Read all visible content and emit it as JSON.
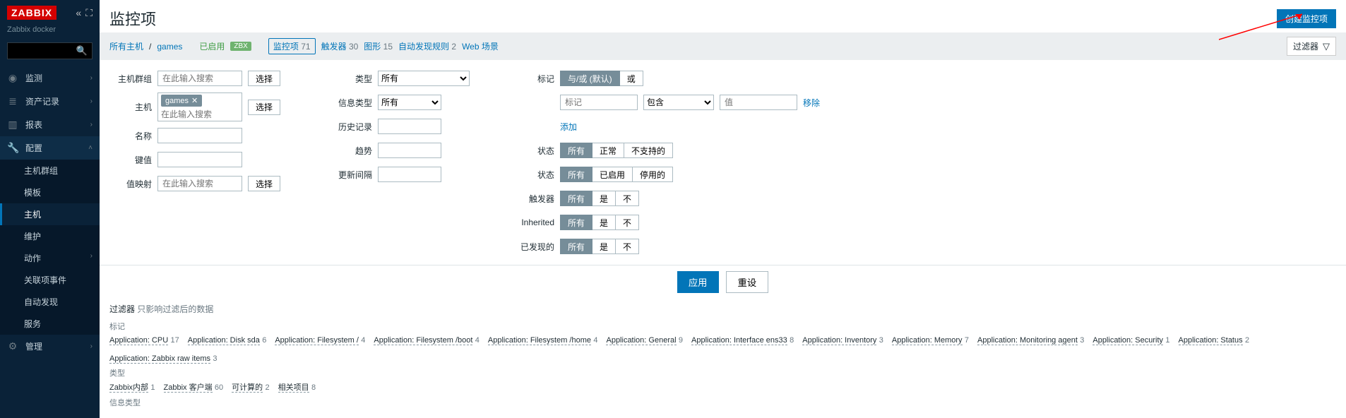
{
  "brand": {
    "logo_text": "ZABBIX",
    "subtitle": "Zabbix docker"
  },
  "sidebar": {
    "search_placeholder": "",
    "items": [
      {
        "label": "监测",
        "icon": "◉"
      },
      {
        "label": "资产记录",
        "icon": "≣"
      },
      {
        "label": "报表",
        "icon": "▥"
      },
      {
        "label": "配置",
        "icon": "🔧",
        "active": true
      },
      {
        "label": "管理",
        "icon": "⚙"
      }
    ],
    "config_sub": [
      {
        "label": "主机群组"
      },
      {
        "label": "模板"
      },
      {
        "label": "主机",
        "active": true
      },
      {
        "label": "维护"
      },
      {
        "label": "动作"
      },
      {
        "label": "关联项事件"
      },
      {
        "label": "自动发现"
      },
      {
        "label": "服务"
      }
    ]
  },
  "page": {
    "title": "监控项",
    "create_button": "创建监控项",
    "filter_toggle": "过滤器"
  },
  "breadcrumb": {
    "all_hosts": "所有主机",
    "host": "games",
    "enabled": "已启用",
    "badge": "ZBX",
    "tabs": [
      {
        "label": "监控项",
        "count": "71",
        "active": true
      },
      {
        "label": "触发器",
        "count": "30"
      },
      {
        "label": "图形",
        "count": "15"
      },
      {
        "label": "自动发现规则",
        "count": "2"
      },
      {
        "label": "Web 场景",
        "count": ""
      }
    ]
  },
  "filter": {
    "labels": {
      "hostgroups": "主机群组",
      "hosts": "主机",
      "name": "名称",
      "key": "键值",
      "valuemap": "值映射",
      "type": "类型",
      "infotype": "信息类型",
      "history": "历史记录",
      "trends": "趋势",
      "interval": "更新间隔",
      "tags": "标记",
      "state": "状态",
      "status": "状态",
      "triggers": "触发器",
      "inherited": "Inherited",
      "discovered": "已发现的"
    },
    "placeholder_search": "在此输入搜索",
    "select_btn": "选择",
    "host_chip": "games",
    "type_all": "所有",
    "info_all": "所有",
    "tag_mode": {
      "and_or": "与/或 (默认)",
      "or": "或"
    },
    "tag_row": {
      "tag_ph": "标记",
      "op_contains": "包含",
      "val_ph": "值",
      "remove": "移除"
    },
    "add_link": "添加",
    "state_opts": [
      "所有",
      "正常",
      "不支持的"
    ],
    "status_opts": [
      "所有",
      "已启用",
      "停用的"
    ],
    "yn_opts": [
      "所有",
      "是",
      "不"
    ],
    "apply": "应用",
    "reset": "重设"
  },
  "subfilter": {
    "header": "过滤器",
    "hint": "只影响过滤后的数据",
    "tags_label": "标记",
    "tags": [
      {
        "label": "Application: CPU",
        "count": "17"
      },
      {
        "label": "Application: Disk sda",
        "count": "6"
      },
      {
        "label": "Application: Filesystem /",
        "count": "4"
      },
      {
        "label": "Application: Filesystem /boot",
        "count": "4"
      },
      {
        "label": "Application: Filesystem /home",
        "count": "4"
      },
      {
        "label": "Application: General",
        "count": "9"
      },
      {
        "label": "Application: Interface ens33",
        "count": "8"
      },
      {
        "label": "Application: Inventory",
        "count": "3"
      },
      {
        "label": "Application: Memory",
        "count": "7"
      },
      {
        "label": "Application: Monitoring agent",
        "count": "3"
      },
      {
        "label": "Application: Security",
        "count": "1"
      },
      {
        "label": "Application: Status",
        "count": "2"
      },
      {
        "label": "Application: Zabbix raw items",
        "count": "3"
      }
    ],
    "type_label": "类型",
    "types": [
      {
        "label": "Zabbix内部",
        "count": "1"
      },
      {
        "label": "Zabbix 客户端",
        "count": "60"
      },
      {
        "label": "可计算的",
        "count": "2"
      },
      {
        "label": "相关项目",
        "count": "8"
      }
    ],
    "infotype_label": "信息类型"
  }
}
